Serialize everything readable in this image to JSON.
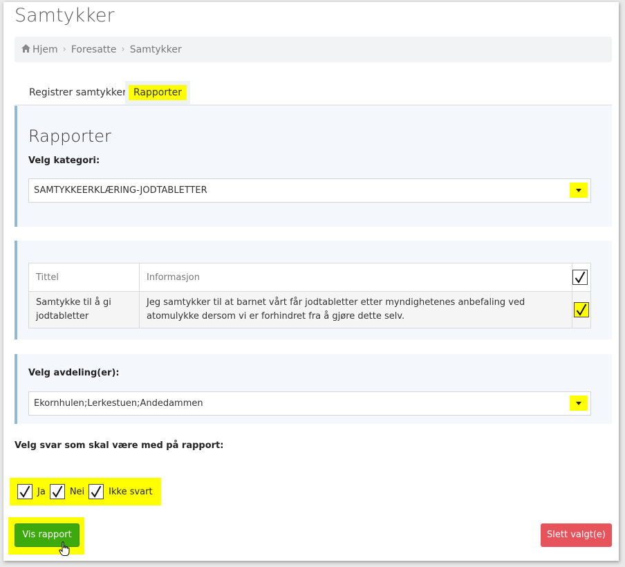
{
  "page": {
    "title": "Samtykker"
  },
  "breadcrumb": {
    "home": "Hjem",
    "item2": "Foresatte",
    "item3": "Samtykker"
  },
  "tabs": [
    {
      "label": "Registrer samtykker"
    },
    {
      "label": "Rapporter"
    }
  ],
  "reports": {
    "heading": "Rapporter",
    "category_label": "Velg kategori:",
    "category_value": "SAMTYKKEERKLÆRING-JODTABLETTER"
  },
  "table": {
    "headers": [
      "Tittel",
      "Informasjon"
    ],
    "rows": [
      {
        "title": "Samtykke til å gi jodtabletter",
        "info": "Jeg samtykker til at barnet vårt får jodtabletter etter myndighetenes anbefaling ved atomulykke dersom vi er forhindret fra å gjøre dette selv.",
        "checked": true
      }
    ],
    "header_checked": true
  },
  "departments": {
    "label": "Velg avdeling(er):",
    "value": "Ekornhulen;Lerkestuen;Andedammen"
  },
  "answers": {
    "label": "Velg svar som skal være med på rapport:",
    "options": [
      {
        "label": "Ja",
        "checked": true
      },
      {
        "label": "Nei",
        "checked": true
      },
      {
        "label": "Ikke svart",
        "checked": true
      }
    ]
  },
  "buttons": {
    "show_report": "Vis rapport",
    "delete_selected": "Slett valgt(e)"
  },
  "colors": {
    "highlight": "#ffff00",
    "primary": "#3caa0d",
    "danger": "#e6535b",
    "panel_border": "#8fb8de"
  }
}
